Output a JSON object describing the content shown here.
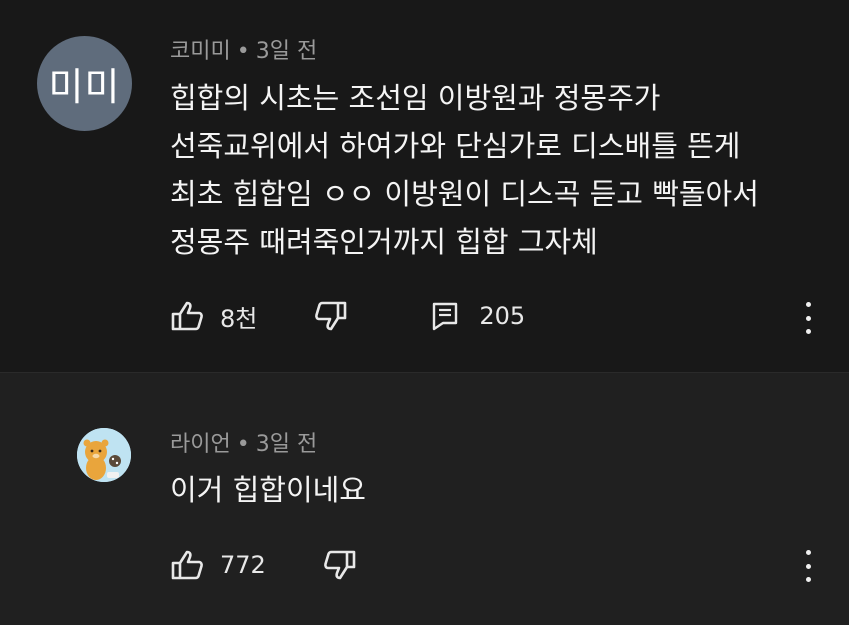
{
  "comments": [
    {
      "avatar_text": "미미",
      "author": "코미미",
      "age": "3일 전",
      "text": "힙합의 시초는 조선임 이방원과 정몽주가\n선죽교위에서 하여가와 단심가로 디스배틀 뜬게\n최초 힙합임 ㅇㅇ 이방원이 디스곡 듣고 빡돌아서\n정몽주 때려죽인거까지 힙합 그자체",
      "likes": "8천",
      "replies": "205"
    },
    {
      "author": "라이언",
      "age": "3일 전",
      "text": "이거 힙합이네요",
      "likes": "772"
    }
  ],
  "icons": {
    "like": "thumb-up-icon",
    "dislike": "thumb-down-icon",
    "reply": "comment-icon",
    "more": "more-vert-icon"
  },
  "colors": {
    "background": "#181818",
    "background_alt": "#202020",
    "avatar": "#5f6c7c",
    "meta_text": "#9a9a9a"
  }
}
